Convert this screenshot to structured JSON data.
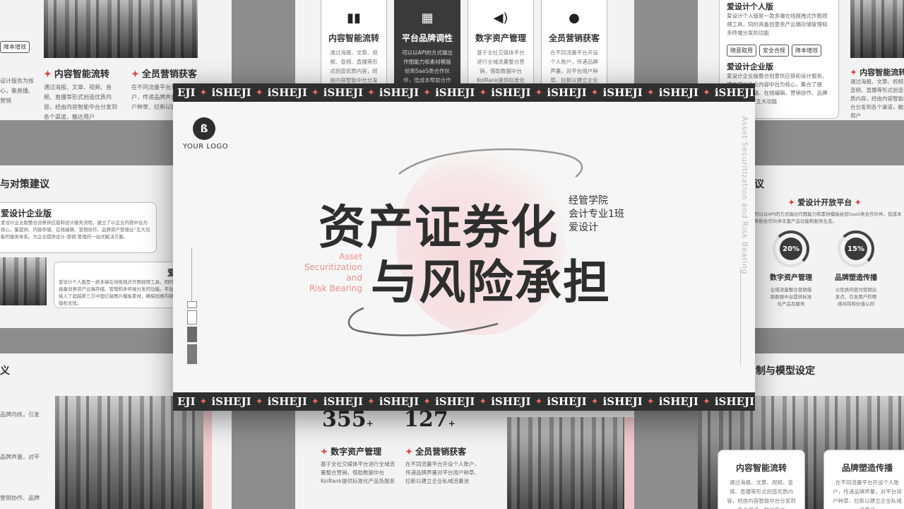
{
  "brand_word": "iSHEJI",
  "main": {
    "logo_text": "YOUR LOGO",
    "title_line1": "资产证券化",
    "title_line2": "与风险承担",
    "subtitle": [
      "经管学院",
      "会计专业1班",
      "爱设计"
    ],
    "english": [
      "Asset",
      "Securitization",
      "and",
      "Risk Bearing"
    ],
    "vertical_text": "Asset Securitization and Risk Bearing"
  },
  "bg_top_left": {
    "tags": [
      "降本增效"
    ],
    "items": [
      {
        "title": "内容智能流转",
        "body": "通过海报、文章、视频、音频、直播等形式创造优质内容，经由内容智能中台分发到各个渠道，触达用户"
      },
      {
        "title": "全员营销获客",
        "body": "在不同流量平台开设个人账户，传递品牌声量，对平台用户种草、拉新以建立企业私域"
      }
    ],
    "left_body": "设计服务为核心，集直播、营销"
  },
  "bg_top_mid": {
    "cards": [
      {
        "icon": "bar-chart-icon",
        "title": "内容智能流转",
        "body": "通过海报、文章、视频、音频、直播等形式创造优质内容，经由内容智能中台分发"
      },
      {
        "icon": "calendar-icon",
        "title": "平台品牌调性",
        "body": "可以以API的方式输出作图能力和素材模版给到SaaS类合作伙伴，低成本帮助合作伙伴"
      },
      {
        "icon": "megaphone-icon",
        "title": "数字资产管理",
        "body": "基于全社交媒体平台进行全域流量整合营销，借助数据中台KolRank提供标准化产品"
      },
      {
        "icon": "user-icon",
        "title": "全员营销获客",
        "body": "在不同流量平台开设个人账户，传递品牌声量，对平台用户种草、拉新以建立企业"
      }
    ]
  },
  "bg_top_right": {
    "title1": "爱设计个人版",
    "body1": "爱设计个人版是一款多端在线拖拽式作图视频工具，同时具备创意资产云端存储管理和多终端分发的功能",
    "tags": [
      "随意取用",
      "安全合规",
      "降本增效"
    ],
    "title2": "爱设计企业版",
    "body2": "爱设计企业版整合创意供应链和设计服务，建立了以企业内容中台为核心，集合了提供、内容存储、在线编辑、营销协作、品牌资产管理云”五大功能",
    "item_title": "内容智能流转",
    "item_body": "通过海报、文章、视频、音频、直播等形式创造优质内容，经由内容智能中台分发到各个渠道，触达用户"
  },
  "bg_mid_left": {
    "heading": "与对策建议",
    "box1_title": "爱设计企业版",
    "box1_body": "爱设计企业版整合创意供应链和设计服务流程，建立了以企业内容中台为核心，集提供、内容存储、在线编辑、营销协作、品牌资产管理云”五大功能的服务体系。为企业提供设计-营销-管理的一站式解决方案。",
    "box2_title": "爱",
    "box2_body": "爱设计个人版是一款多端在线拖拽式作图视频工具，同时具备创意资产云端存储、管理和多终端分发的功能。平台接入了超越第三方中国亿级图片模板素材，确保创意内容版权无忧。"
  },
  "bg_mid_right": {
    "heading": "议",
    "section_title": "爱设计开放平台",
    "section_body": "可以以API的方式输出作图能力和素材模板给到SaaS类合作伙伴，低成本帮助合作伙伴丰富产品功能和服务生态。",
    "metrics": [
      {
        "value": "20%",
        "label": "数字资产管理",
        "body": "全域流量整合营销借助数据中台提供标准化产品及服务"
      },
      {
        "value": "15%",
        "label": "品牌塑造传播",
        "body": "以优质内容为营销出发点，引发用户的情感共鸣和价值认同"
      }
    ]
  },
  "bg_bot_left": {
    "heading": "义",
    "lines": [
      "品牌内核，引发",
      "品牌声量，对平",
      "营销协作、品牌"
    ]
  },
  "bg_bot_mid": {
    "stats": [
      {
        "value": "355",
        "suffix": "+"
      },
      {
        "value": "127",
        "suffix": "+"
      }
    ],
    "items": [
      {
        "title": "数字资产管理",
        "body": "基于全社交媒体平台进行全域流量整合营销，借助数据中台KolRank提供标准化产品及服务"
      },
      {
        "title": "全员营销获客",
        "body": "在不同流量平台开设个人账户，传递品牌声量对平台用户种草、拉新以建立企业私域流量池"
      }
    ]
  },
  "bg_bot_right": {
    "heading": "制与模型设定",
    "cards": [
      {
        "title": "内容智能流转",
        "body": "通过海报、文章、视频、音频、直播等形式创造优质内容，经由内容智能中台分发到各个渠道，触达用户"
      },
      {
        "title": "品牌塑造传播",
        "body": "在不同流量平台开设个人账户，传递品牌声量，对平台用户种草、拉新以建立企业私域流量池"
      }
    ]
  }
}
